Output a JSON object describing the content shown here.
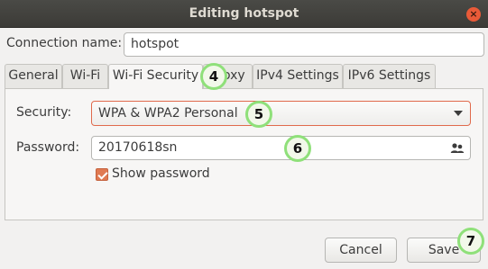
{
  "window": {
    "title": "Editing hotspot",
    "close_glyph": "×"
  },
  "connection": {
    "label": "Connection name:",
    "value": "hotspot"
  },
  "tabs": [
    {
      "label": "General"
    },
    {
      "label": "Wi-Fi"
    },
    {
      "label": "Wi-Fi Security",
      "active": true
    },
    {
      "label": "Proxy"
    },
    {
      "label": "IPv4 Settings"
    },
    {
      "label": "IPv6 Settings"
    }
  ],
  "security": {
    "label": "Security:",
    "value": "WPA & WPA2 Personal"
  },
  "password": {
    "label": "Password:",
    "value": "20170618sn",
    "icon": "users-icon"
  },
  "show_password": {
    "label": "Show password",
    "checked": true
  },
  "buttons": {
    "cancel": "Cancel",
    "save": "Save"
  },
  "markers": {
    "tab": "4",
    "security": "5",
    "password": "6",
    "save": "7"
  },
  "colors": {
    "accent": "#e07a52",
    "marker_border": "#8fe07a",
    "titlebar": "#3c3b37"
  }
}
